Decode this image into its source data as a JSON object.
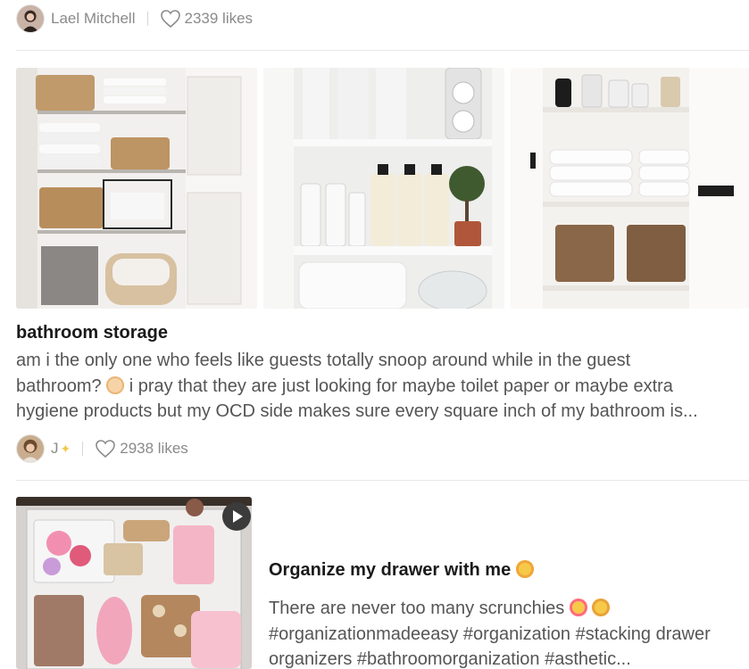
{
  "post_top": {
    "author": "Lael Mitchell",
    "likes": "2339 likes",
    "avatar": "avatar-photo-icon"
  },
  "post_main": {
    "images": [
      "linen-closet-baskets-photo",
      "laundry-shelf-bottles-photo",
      "cabinet-towels-baskets-photo"
    ],
    "title": "bathroom storage",
    "body_line1": "am i the only one who feels like guests totally snoop around while in the guest",
    "body_line2_a": "bathroom? ",
    "body_line2_b": " i pray that they are just looking for maybe toilet paper or maybe extra",
    "body_line3": "hygiene products but my OCD side makes sure every square inch of my bathroom is...",
    "emoji": "flushed-face-emoji",
    "author": "J",
    "author_emoji": "sparkles-emoji",
    "likes": "2938 likes"
  },
  "post_video": {
    "title": "Organize my drawer with me",
    "title_emoji": "smiling-face-with-hearts-emoji",
    "body_line1": "There are never too many scrunchies",
    "body_emojis": [
      "star-struck-emoji",
      "zany-face-emoji"
    ],
    "body_line2": "#organizationmadeeasy #organization #stacking drawer",
    "body_line3": "organizers #bathroomorganization #asthetic...",
    "thumbnail": "drawer-scrunchies-video-thumbnail",
    "play": "play-icon"
  },
  "colors": {
    "muted_text": "#8a8a8a",
    "title_text": "#1a1a1a",
    "body_text": "#555555",
    "divider": "#e8e8e8"
  }
}
